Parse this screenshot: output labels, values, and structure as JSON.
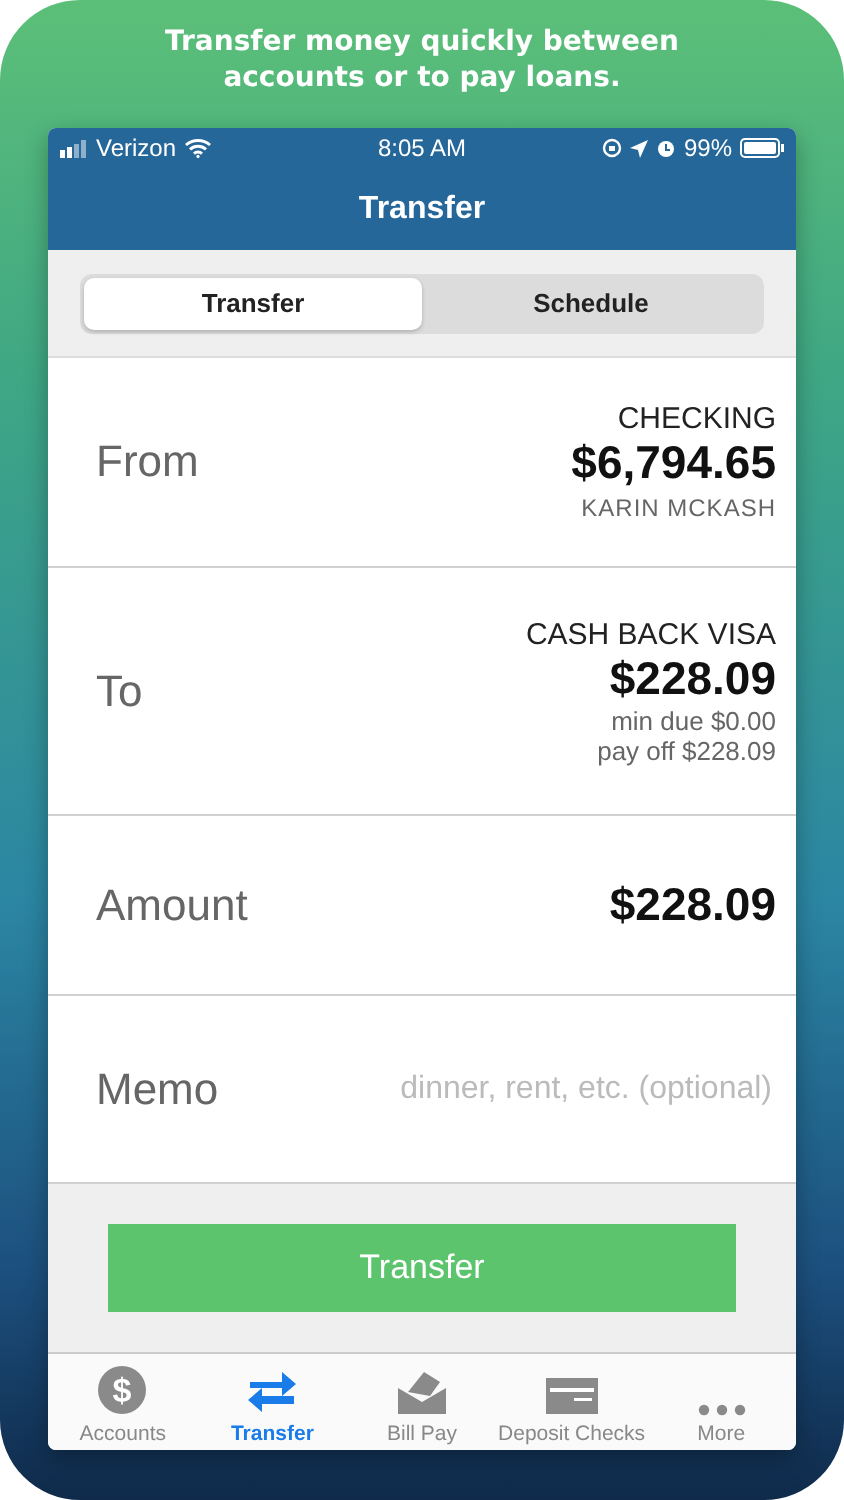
{
  "headline": "Transfer money quickly between accounts or to pay loans.",
  "status_bar": {
    "carrier": "Verizon",
    "time": "8:05 AM",
    "battery": "99%"
  },
  "nav_title": "Transfer",
  "segments": [
    {
      "label": "Transfer",
      "selected": true
    },
    {
      "label": "Schedule",
      "selected": false
    }
  ],
  "from": {
    "label": "From",
    "account": "CHECKING",
    "amount": "$6,794.65",
    "owner": "KARIN MCKASH"
  },
  "to": {
    "label": "To",
    "account": "CASH BACK VISA",
    "amount": "$228.09",
    "notes": [
      "min due $0.00",
      "pay off $228.09"
    ]
  },
  "amount": {
    "label": "Amount",
    "value": "$228.09"
  },
  "memo": {
    "label": "Memo",
    "placeholder": "dinner, rent, etc. (optional)"
  },
  "submit": "Transfer",
  "tab_bar": [
    {
      "label": "Accounts",
      "kind": "dollar",
      "glyph": "$",
      "selected": false
    },
    {
      "label": "Transfer",
      "kind": "arrows",
      "selected": true
    },
    {
      "label": "Bill Pay",
      "kind": "envelope",
      "selected": false
    },
    {
      "label": "Deposit Checks",
      "kind": "check",
      "selected": false
    },
    {
      "label": "More",
      "kind": "dots",
      "selected": false
    }
  ]
}
